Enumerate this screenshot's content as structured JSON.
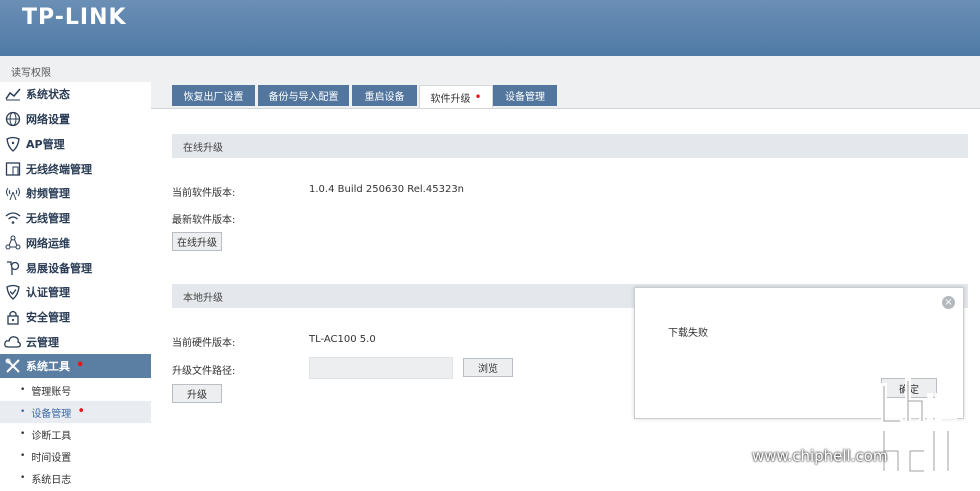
{
  "app": {
    "logo": "TP-LINK",
    "permission": "读写权限"
  },
  "sidebar": {
    "items": [
      {
        "label": "系统状态",
        "icon": "chart-line-icon"
      },
      {
        "label": "网络设置",
        "icon": "globe-icon"
      },
      {
        "label": "AP管理",
        "icon": "shield-ap-icon"
      },
      {
        "label": "无线终端管理",
        "icon": "device-icon"
      },
      {
        "label": "射频管理",
        "icon": "radio-tower-icon"
      },
      {
        "label": "无线管理",
        "icon": "wifi-icon"
      },
      {
        "label": "网络运维",
        "icon": "network-ops-icon"
      },
      {
        "label": "易展设备管理",
        "icon": "easy-expand-icon"
      },
      {
        "label": "认证管理",
        "icon": "auth-check-icon"
      },
      {
        "label": "安全管理",
        "icon": "lock-icon"
      },
      {
        "label": "云管理",
        "icon": "cloud-icon"
      },
      {
        "label": "系统工具",
        "icon": "tools-icon"
      }
    ],
    "sub_items": [
      "管理账号",
      "设备管理",
      "诊断工具",
      "时间设置",
      "系统日志"
    ]
  },
  "tabs": [
    "恢复出厂设置",
    "备份与导入配置",
    "重启设备",
    "软件升级",
    "设备管理"
  ],
  "online_upgrade": {
    "title": "在线升级",
    "current_version_label": "当前软件版本:",
    "current_version_value": "1.0.4 Build 250630 Rel.45323n",
    "latest_version_label": "最新软件版本:",
    "button": "在线升级"
  },
  "local_upgrade": {
    "title": "本地升级",
    "hardware_label": "当前硬件版本:",
    "hardware_value": "TL-AC100 5.0",
    "path_label": "升级文件路径:",
    "browse_button": "浏览",
    "upgrade_button": "升级"
  },
  "dialog": {
    "message": "下载失败",
    "ok_button": "确定"
  },
  "watermark": {
    "text": "www.chiphell.com"
  },
  "colors": {
    "header": "#5b82ac",
    "accent": "#52769e",
    "alert_dot": "#e0181c"
  }
}
